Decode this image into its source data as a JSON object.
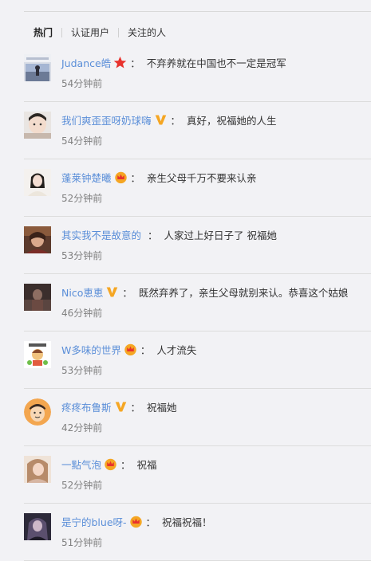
{
  "tabs": [
    "热门",
    "认证用户",
    "关注的人"
  ],
  "colors": {
    "username": "#5a8ed8",
    "text": "#333333",
    "time": "#808080",
    "vip_orange": "#f5a623",
    "red_star": "#e8322d"
  },
  "comments": [
    {
      "user": "Judance皓",
      "badge": "red-star-icon",
      "text": "不弃养就在中国也不一定是冠军",
      "time": "54分钟前"
    },
    {
      "user": "我们爽歪歪呀奶球嗨",
      "badge": "vip-v-icon",
      "text": "真好，祝福她的人生",
      "time": "54分钟前"
    },
    {
      "user": "蓬莱钟楚曦",
      "badge": "crown-icon",
      "text": "亲生父母千万不要来认亲",
      "time": "52分钟前"
    },
    {
      "user": "其实我不是故意的",
      "badge": "",
      "text": "人家过上好日子了 祝福她",
      "time": "53分钟前"
    },
    {
      "user": "Nico恵恵",
      "badge": "vip-v-icon",
      "text": "既然弃养了，亲生父母就别来认。恭喜这个姑娘",
      "time": "46分钟前"
    },
    {
      "user": "W多味的世界",
      "badge": "crown-icon",
      "text": "人才流失",
      "time": "53分钟前"
    },
    {
      "user": "疼疼布鲁斯",
      "badge": "vip-v-icon",
      "text": "祝福她",
      "time": "42分钟前"
    },
    {
      "user": "一點气泡",
      "badge": "crown-icon",
      "text": "祝福",
      "time": "52分钟前"
    },
    {
      "user": "是宁的blue呀-",
      "badge": "crown-icon",
      "text": "祝福祝福！",
      "time": "51分钟前"
    }
  ]
}
